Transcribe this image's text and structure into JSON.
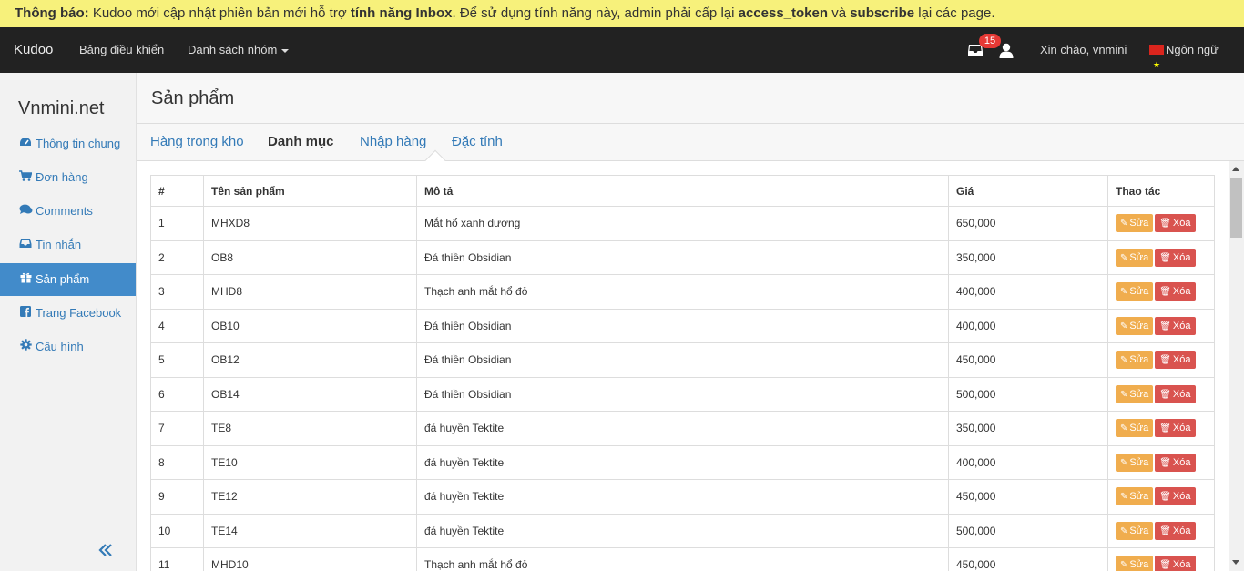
{
  "notice": {
    "label": "Thông báo:",
    "text_1": " Kudoo mới cập nhật phiên bản mới hỗ trợ ",
    "feature": "tính năng Inbox",
    "text_2": ". Để sử dụng tính năng này, admin phải cấp lại ",
    "token": "access_token",
    "text_3": " và ",
    "subscribe": "subscribe",
    "text_4": " lại các page."
  },
  "navbar": {
    "brand": "Kudoo",
    "dashboard": "Bảng điều khiển",
    "groups": "Danh sách nhóm",
    "inbox_count": "15",
    "greeting": "Xin chào, vnmini",
    "language": "Ngôn ngữ"
  },
  "sidebar": {
    "site_title": "Vnmini.net",
    "items": [
      {
        "label": "Thông tin chung",
        "icon": "dashboard-icon"
      },
      {
        "label": "Đơn hàng",
        "icon": "cart-icon"
      },
      {
        "label": "Comments",
        "icon": "comments-icon"
      },
      {
        "label": "Tin nhắn",
        "icon": "inbox-icon"
      },
      {
        "label": "Sản phẩm",
        "icon": "gift-icon"
      },
      {
        "label": "Trang Facebook",
        "icon": "facebook-icon"
      },
      {
        "label": "Cấu hình",
        "icon": "gear-icon"
      }
    ]
  },
  "page": {
    "title": "Sản phẩm"
  },
  "tabs": [
    {
      "label": "Hàng trong kho"
    },
    {
      "label": "Danh mục"
    },
    {
      "label": "Nhập hàng"
    },
    {
      "label": "Đặc tính"
    }
  ],
  "table": {
    "headers": [
      "#",
      "Tên sản phẩm",
      "Mô tả",
      "Giá",
      "Thao tác"
    ],
    "edit_label": "Sửa",
    "delete_label": "Xóa",
    "rows": [
      {
        "num": "1",
        "name": "MHXD8",
        "desc": "Mắt hổ xanh dương",
        "price": "650,000"
      },
      {
        "num": "2",
        "name": "OB8",
        "desc": "Đá thiền Obsidian",
        "price": "350,000"
      },
      {
        "num": "3",
        "name": "MHD8",
        "desc": "Thạch anh mắt hổ đỏ",
        "price": "400,000"
      },
      {
        "num": "4",
        "name": "OB10",
        "desc": "Đá thiền Obsidian",
        "price": "400,000"
      },
      {
        "num": "5",
        "name": "OB12",
        "desc": "Đá thiền Obsidian",
        "price": "450,000"
      },
      {
        "num": "6",
        "name": "OB14",
        "desc": "Đá thiền Obsidian",
        "price": "500,000"
      },
      {
        "num": "7",
        "name": "TE8",
        "desc": "đá huyền Tektite",
        "price": "350,000"
      },
      {
        "num": "8",
        "name": "TE10",
        "desc": "đá huyền Tektite",
        "price": "400,000"
      },
      {
        "num": "9",
        "name": "TE12",
        "desc": "đá huyền Tektite",
        "price": "450,000"
      },
      {
        "num": "10",
        "name": "TE14",
        "desc": "đá huyền Tektite",
        "price": "500,000"
      },
      {
        "num": "11",
        "name": "MHD10",
        "desc": "Thạch anh mắt hổ đỏ",
        "price": "450,000"
      }
    ]
  }
}
